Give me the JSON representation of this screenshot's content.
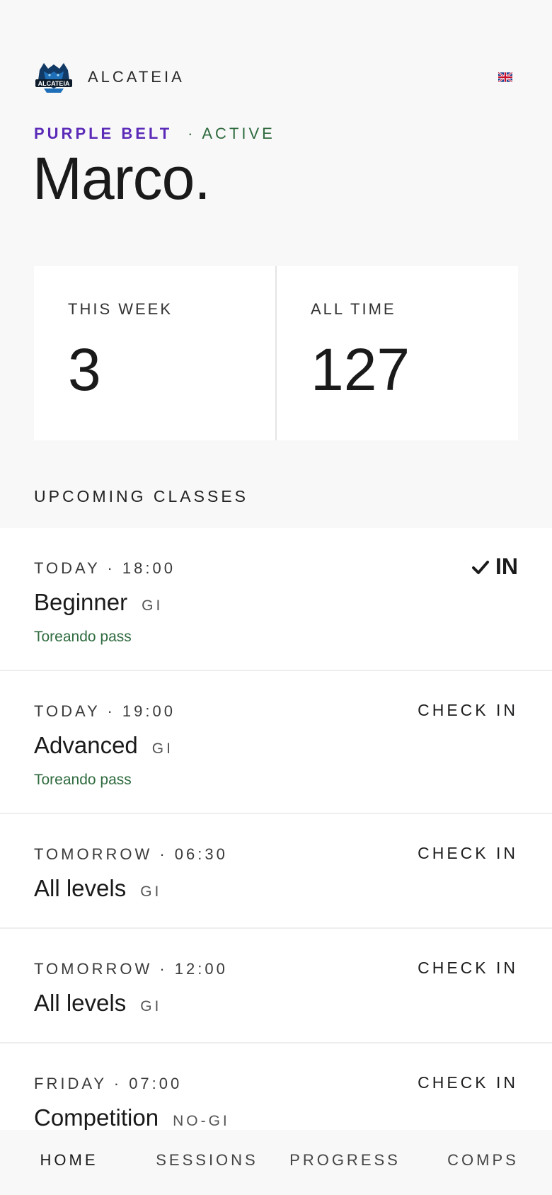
{
  "header": {
    "brand": "ALCATEIA",
    "logo_text": "ALCATEIA",
    "language_icon": "uk-flag-icon"
  },
  "profile": {
    "belt": "PURPLE BELT",
    "status": "· ACTIVE",
    "name": "Marco."
  },
  "stats": [
    {
      "label": "THIS WEEK",
      "value": "3"
    },
    {
      "label": "ALL TIME",
      "value": "127"
    }
  ],
  "upcoming": {
    "title": "UPCOMING CLASSES",
    "classes": [
      {
        "time": "TODAY · 18:00",
        "name": "Beginner",
        "type": "GI",
        "note": "Toreando pass",
        "action": "IN",
        "checked_in": true
      },
      {
        "time": "TODAY · 19:00",
        "name": "Advanced",
        "type": "GI",
        "note": "Toreando pass",
        "action": "CHECK IN",
        "checked_in": false
      },
      {
        "time": "TOMORROW · 06:30",
        "name": "All levels",
        "type": "GI",
        "action": "CHECK IN",
        "checked_in": false
      },
      {
        "time": "TOMORROW · 12:00",
        "name": "All levels",
        "type": "GI",
        "action": "CHECK IN",
        "checked_in": false
      },
      {
        "time": "FRIDAY · 07:00",
        "name": "Competition",
        "type": "NO-GI",
        "action": "CHECK IN",
        "checked_in": false
      }
    ]
  },
  "nav": {
    "items": [
      "HOME",
      "SESSIONS",
      "PROGRESS",
      "COMPS"
    ],
    "active": "HOME"
  },
  "colors": {
    "belt": "#5b2bb8",
    "active": "#2f6b3f",
    "background": "#f8f8f8",
    "card": "#ffffff"
  }
}
